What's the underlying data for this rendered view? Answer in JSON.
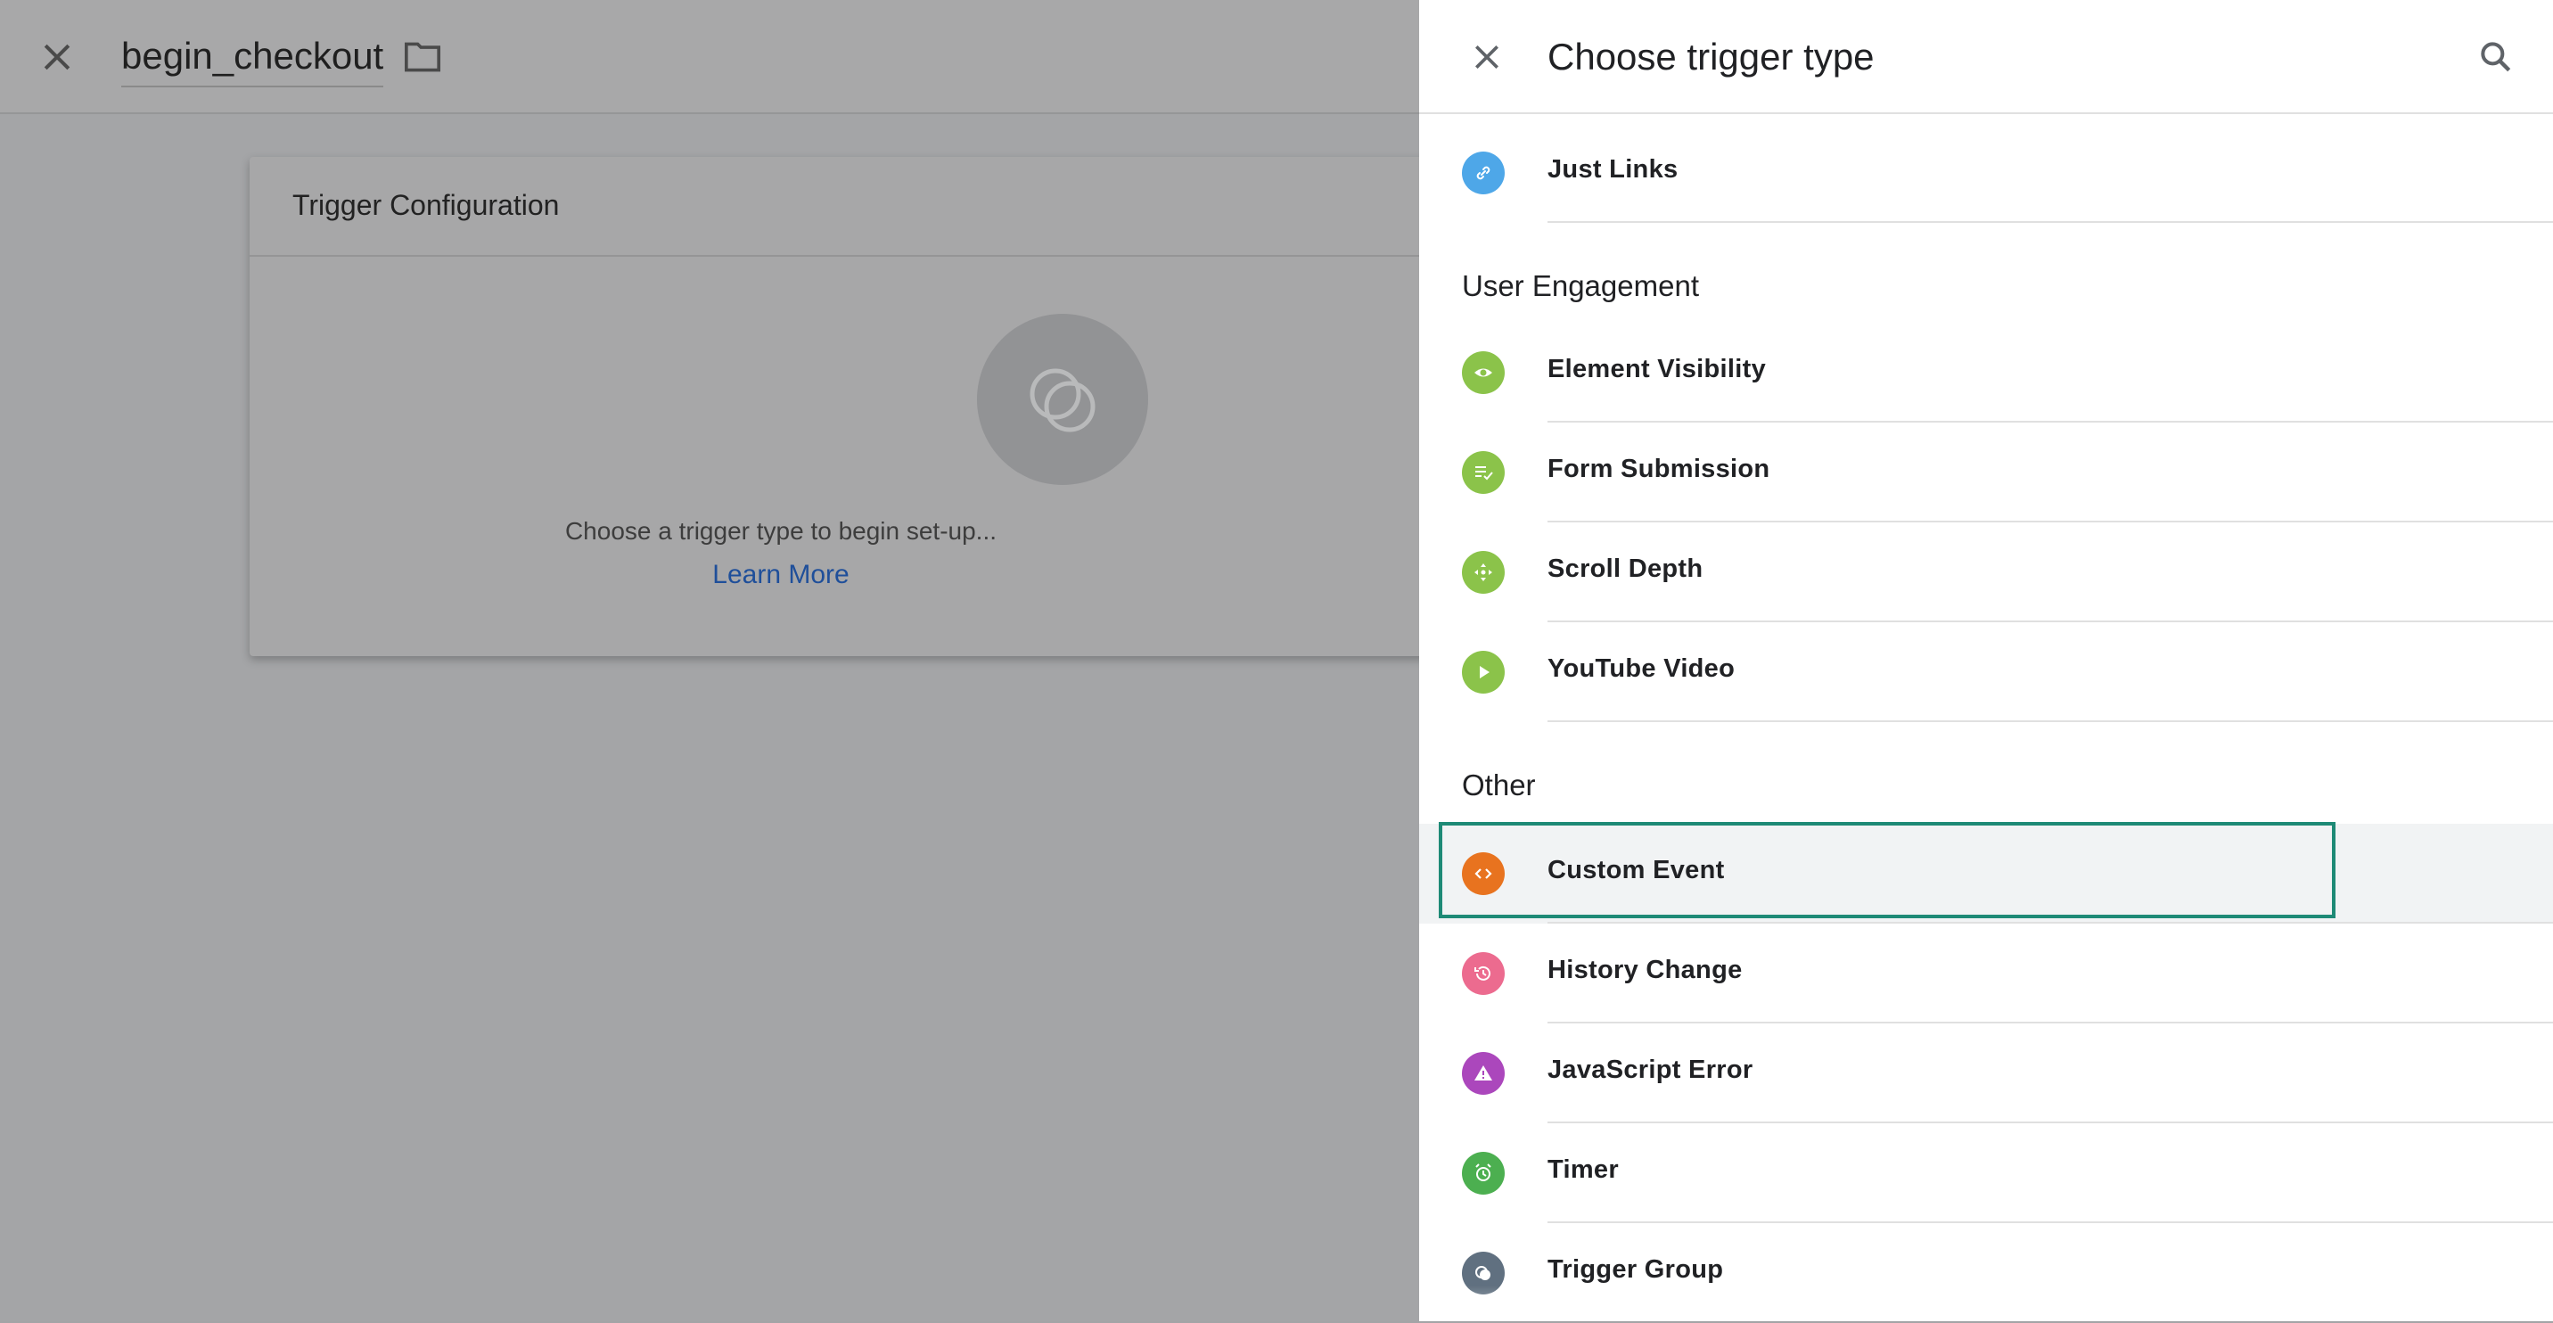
{
  "editor": {
    "tag_name": "begin_checkout",
    "card_title": "Trigger Configuration",
    "card_message": "Choose a trigger type to begin set-up...",
    "card_link": "Learn More"
  },
  "panel": {
    "title": "Choose trigger type",
    "items_top": [
      {
        "label": "Just Links",
        "icon": "link-icon",
        "color": "#4ea7e8"
      }
    ],
    "sections": [
      {
        "title": "User Engagement",
        "items": [
          {
            "label": "Element Visibility",
            "icon": "eye-icon",
            "color": "#8bc34a"
          },
          {
            "label": "Form Submission",
            "icon": "form-check-icon",
            "color": "#8bc34a"
          },
          {
            "label": "Scroll Depth",
            "icon": "move-arrows-icon",
            "color": "#8bc34a"
          },
          {
            "label": "YouTube Video",
            "icon": "play-icon",
            "color": "#8bc34a"
          }
        ]
      },
      {
        "title": "Other",
        "items": [
          {
            "label": "Custom Event",
            "icon": "code-brackets-icon",
            "color": "#e8731f"
          },
          {
            "label": "History Change",
            "icon": "history-icon",
            "color": "#ec6b8f"
          },
          {
            "label": "JavaScript Error",
            "icon": "warning-icon",
            "color": "#ab47bc"
          },
          {
            "label": "Timer",
            "icon": "alarm-clock-icon",
            "color": "#4caf50"
          },
          {
            "label": "Trigger Group",
            "icon": "trigger-group-icon",
            "color": "#607080"
          }
        ]
      }
    ]
  }
}
